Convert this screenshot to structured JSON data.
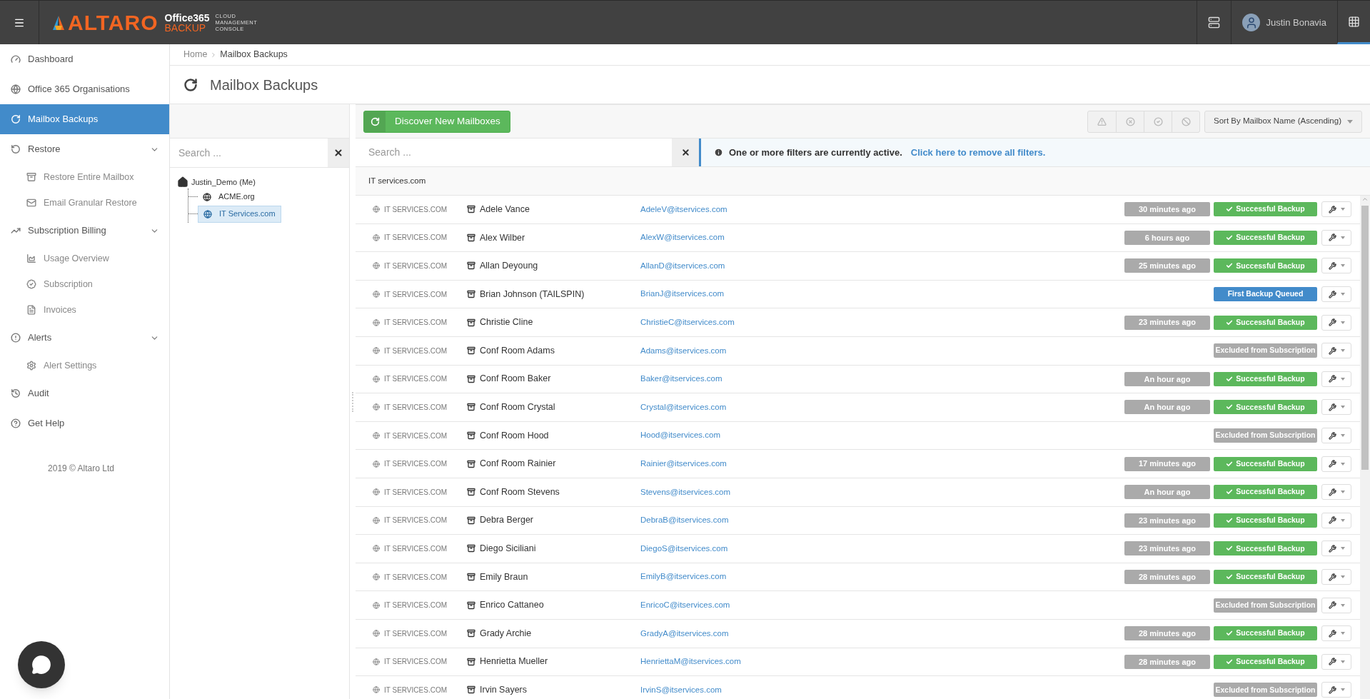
{
  "header": {
    "logo": {
      "brand": "ALTARO",
      "product_top": "Office365",
      "product_bottom": "BACKUP",
      "tagline": [
        "CLOUD",
        "MANAGEMENT",
        "CONSOLE"
      ]
    },
    "user": "Justin Bonavia"
  },
  "sidebar": {
    "items": [
      {
        "kind": "top",
        "label": "Dashboard",
        "selected": false,
        "expandable": false
      },
      {
        "kind": "top",
        "label": "Office 365 Organisations",
        "selected": false,
        "expandable": false
      },
      {
        "kind": "top",
        "label": "Mailbox Backups",
        "selected": true,
        "expandable": false
      },
      {
        "kind": "top",
        "label": "Restore",
        "selected": false,
        "expandable": true
      },
      {
        "kind": "sub",
        "label": "Restore Entire Mailbox",
        "selected": false,
        "expandable": false
      },
      {
        "kind": "sub",
        "label": "Email Granular Restore",
        "selected": false,
        "expandable": false
      },
      {
        "kind": "top",
        "label": "Subscription Billing",
        "selected": false,
        "expandable": true
      },
      {
        "kind": "sub",
        "label": "Usage Overview",
        "selected": false,
        "expandable": false
      },
      {
        "kind": "sub",
        "label": "Subscription",
        "selected": false,
        "expandable": false
      },
      {
        "kind": "sub",
        "label": "Invoices",
        "selected": false,
        "expandable": false
      },
      {
        "kind": "top",
        "label": "Alerts",
        "selected": false,
        "expandable": true
      },
      {
        "kind": "sub",
        "label": "Alert Settings",
        "selected": false,
        "expandable": false
      },
      {
        "kind": "top",
        "label": "Audit",
        "selected": false,
        "expandable": false
      },
      {
        "kind": "top",
        "label": "Get Help",
        "selected": false,
        "expandable": false
      }
    ],
    "footer": "2019 © Altaro Ltd"
  },
  "breadcrumb": [
    "Home",
    "Mailbox Backups"
  ],
  "page_title": "Mailbox Backups",
  "tree": {
    "search": {
      "placeholder": "Search ..."
    },
    "root": {
      "label": "Justin_Demo (Me)",
      "children": [
        {
          "label": "ACME.org",
          "selected": false
        },
        {
          "label": "IT Services.com",
          "selected": true
        }
      ]
    }
  },
  "toolbar": {
    "discover_button": "Discover New Mailboxes",
    "sort": "Sort By Mailbox Name (Ascending)"
  },
  "filter": {
    "search": {
      "placeholder": "Search ..."
    },
    "notice": "One or more filters are currently active.",
    "notice_link": "Click here to remove all filters."
  },
  "group": "IT services.com",
  "rows": [
    {
      "org": "IT SERVICES.COM",
      "name": "Adele Vance",
      "email": "AdeleV@itservices.com",
      "time": "30 minutes ago",
      "kind": "success",
      "status": "Successful Backup"
    },
    {
      "org": "IT SERVICES.COM",
      "name": "Alex Wilber",
      "email": "AlexW@itservices.com",
      "time": "6 hours ago",
      "kind": "success",
      "status": "Successful Backup"
    },
    {
      "org": "IT SERVICES.COM",
      "name": "Allan Deyoung",
      "email": "AllanD@itservices.com",
      "time": "25 minutes ago",
      "kind": "success",
      "status": "Successful Backup"
    },
    {
      "org": "IT SERVICES.COM",
      "name": "Brian Johnson (TAILSPIN)",
      "email": "BrianJ@itservices.com",
      "kind": "queued",
      "status": "First Backup Queued"
    },
    {
      "org": "IT SERVICES.COM",
      "name": "Christie Cline",
      "email": "ChristieC@itservices.com",
      "time": "23 minutes ago",
      "kind": "success",
      "status": "Successful Backup"
    },
    {
      "org": "IT SERVICES.COM",
      "name": "Conf Room Adams",
      "email": "Adams@itservices.com",
      "kind": "excluded",
      "status": "Excluded from Subscription"
    },
    {
      "org": "IT SERVICES.COM",
      "name": "Conf Room Baker",
      "email": "Baker@itservices.com",
      "time": "An hour ago",
      "kind": "success",
      "status": "Successful Backup"
    },
    {
      "org": "IT SERVICES.COM",
      "name": "Conf Room Crystal",
      "email": "Crystal@itservices.com",
      "time": "An hour ago",
      "kind": "success",
      "status": "Successful Backup"
    },
    {
      "org": "IT SERVICES.COM",
      "name": "Conf Room Hood",
      "email": "Hood@itservices.com",
      "kind": "excluded",
      "status": "Excluded from Subscription"
    },
    {
      "org": "IT SERVICES.COM",
      "name": "Conf Room Rainier",
      "email": "Rainier@itservices.com",
      "time": "17 minutes ago",
      "kind": "success",
      "status": "Successful Backup"
    },
    {
      "org": "IT SERVICES.COM",
      "name": "Conf Room Stevens",
      "email": "Stevens@itservices.com",
      "time": "An hour ago",
      "kind": "success",
      "status": "Successful Backup"
    },
    {
      "org": "IT SERVICES.COM",
      "name": "Debra Berger",
      "email": "DebraB@itservices.com",
      "time": "23 minutes ago",
      "kind": "success",
      "status": "Successful Backup"
    },
    {
      "org": "IT SERVICES.COM",
      "name": "Diego Siciliani",
      "email": "DiegoS@itservices.com",
      "time": "23 minutes ago",
      "kind": "success",
      "status": "Successful Backup"
    },
    {
      "org": "IT SERVICES.COM",
      "name": "Emily Braun",
      "email": "EmilyB@itservices.com",
      "time": "28 minutes ago",
      "kind": "success",
      "status": "Successful Backup"
    },
    {
      "org": "IT SERVICES.COM",
      "name": "Enrico Cattaneo",
      "email": "EnricoC@itservices.com",
      "kind": "excluded",
      "status": "Excluded from Subscription"
    },
    {
      "org": "IT SERVICES.COM",
      "name": "Grady Archie",
      "email": "GradyA@itservices.com",
      "time": "28 minutes ago",
      "kind": "success",
      "status": "Successful Backup"
    },
    {
      "org": "IT SERVICES.COM",
      "name": "Henrietta Mueller",
      "email": "HenriettaM@itservices.com",
      "time": "28 minutes ago",
      "kind": "success",
      "status": "Successful Backup"
    },
    {
      "org": "IT SERVICES.COM",
      "name": "Irvin Sayers",
      "email": "IrvinS@itservices.com",
      "kind": "excluded",
      "status": "Excluded from Subscription"
    }
  ]
}
